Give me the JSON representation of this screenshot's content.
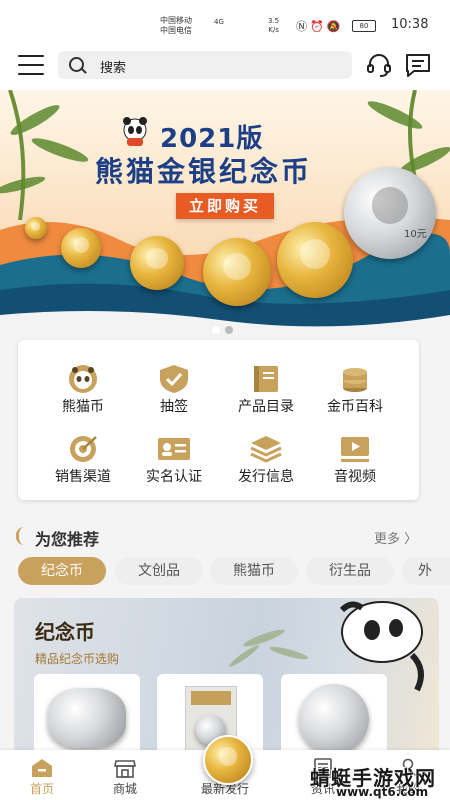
{
  "status_bar": {
    "carrier1": "中国移动",
    "carrier2": "中国电信",
    "network": "4G",
    "speed_value": "3.5",
    "speed_unit": "K/s",
    "battery": "80",
    "time": "10:38"
  },
  "topbar": {
    "search_placeholder": "搜索",
    "menu_icon": "hamburger-icon",
    "service_icon": "headset-icon",
    "message_icon": "message-icon"
  },
  "banner": {
    "year_title": "2021版",
    "main_title": "熊猫金银纪念币",
    "buy_label": "立即购买",
    "coin_label": "10元",
    "slide_index": 1,
    "slide_count": 2
  },
  "grid": {
    "items": [
      {
        "label": "熊猫币",
        "icon": "panda-icon"
      },
      {
        "label": "抽签",
        "icon": "shield-check-icon"
      },
      {
        "label": "产品目录",
        "icon": "book-icon"
      },
      {
        "label": "金币百科",
        "icon": "coin-stack-icon"
      },
      {
        "label": "销售渠道",
        "icon": "target-icon"
      },
      {
        "label": "实名认证",
        "icon": "id-card-icon"
      },
      {
        "label": "发行信息",
        "icon": "layers-icon"
      },
      {
        "label": "音视频",
        "icon": "video-icon"
      }
    ]
  },
  "recommend": {
    "title": "为您推荐",
    "more_label": "更多 〉",
    "tabs": [
      {
        "label": "纪念币",
        "active": true
      },
      {
        "label": "文创品",
        "active": false
      },
      {
        "label": "熊猫币",
        "active": false
      },
      {
        "label": "衍生品",
        "active": false
      },
      {
        "label": "外",
        "active": false
      }
    ]
  },
  "commem_card": {
    "title": "纪念币",
    "subtitle": "精品纪念币选购"
  },
  "bottom_nav": {
    "items": [
      {
        "label": "首页",
        "icon": "home-icon",
        "active": true
      },
      {
        "label": "商城",
        "icon": "store-icon",
        "active": false
      },
      {
        "label": "最新发行",
        "icon": "coin-icon",
        "active": false
      },
      {
        "label": "资讯",
        "icon": "news-icon",
        "active": false
      },
      {
        "label": "我的",
        "icon": "user-icon",
        "active": false
      }
    ]
  },
  "watermark": {
    "line1": "蜻蜓手游戏网",
    "line2": "www.qt6.com"
  },
  "colors": {
    "accent": "#c8a15c",
    "title_blue": "#1d3f86",
    "buy_button": "#e85b23"
  }
}
